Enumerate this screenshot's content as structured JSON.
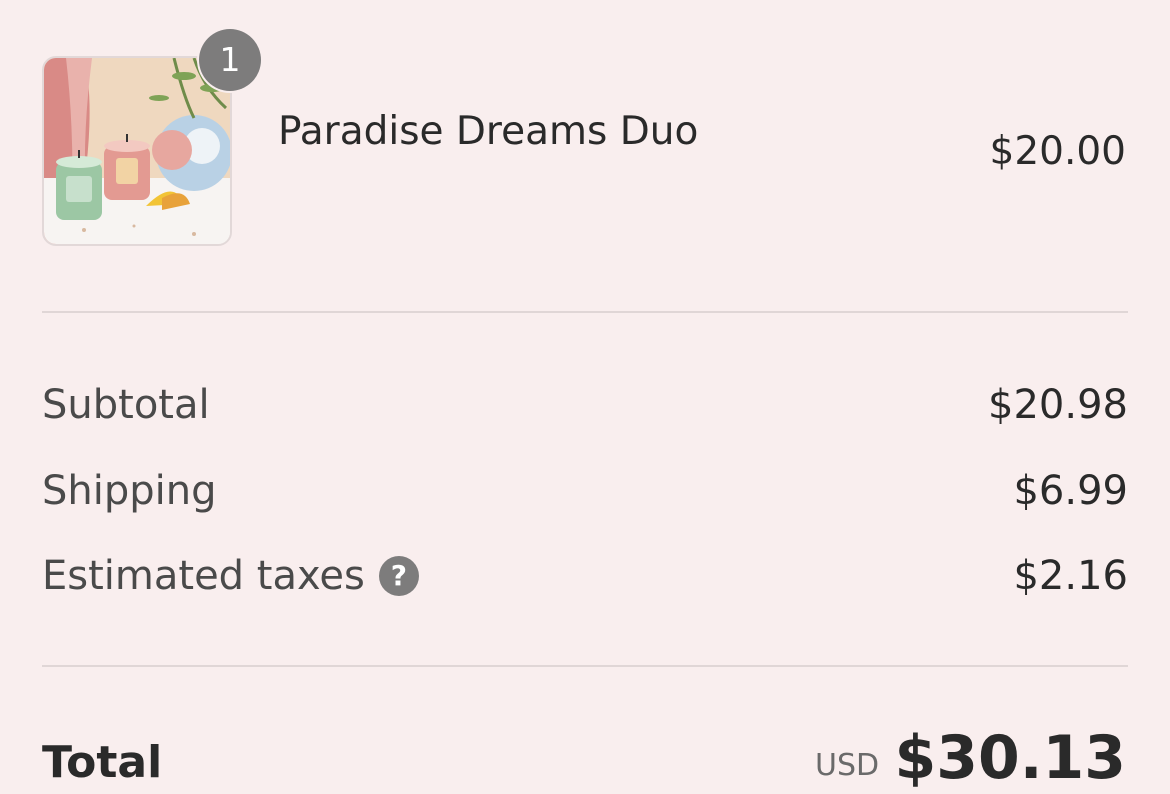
{
  "cart_item": {
    "name": "Paradise Dreams Duo",
    "quantity": "1",
    "price": "$20.00",
    "image_icon": "candle-product-image"
  },
  "summary": {
    "subtotal_label": "Subtotal",
    "subtotal_value": "$20.98",
    "shipping_label": "Shipping",
    "shipping_value": "$6.99",
    "taxes_label": "Estimated taxes",
    "taxes_help": "?",
    "taxes_value": "$2.16"
  },
  "total": {
    "label": "Total",
    "currency": "USD",
    "value": "$30.13"
  },
  "colors": {
    "background": "#f9eeee",
    "badge": "#7d7c7c",
    "divider": "#e0d6d6",
    "text": "#2a2a2a"
  }
}
